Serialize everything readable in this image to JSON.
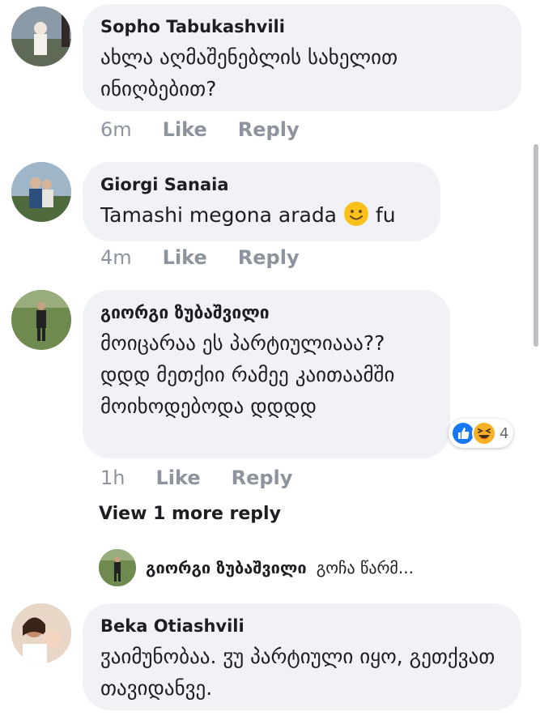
{
  "comments": [
    {
      "author": "Sopho Tabukashvili",
      "text": "ახლა აღმაშენებლის სახელით ინიღბებით?",
      "time": "6m",
      "like": "Like",
      "reply": "Reply"
    },
    {
      "author": "Giorgi Sanaia",
      "text_before_emoji": "Tamashi megona arada ",
      "emoji": "smiling-face",
      "text_after_emoji": " fu",
      "time": "4m",
      "like": "Like",
      "reply": "Reply"
    },
    {
      "author": "გიორგი ზუბაშვილი",
      "text": "მოიცარაა ეს პარტიულიააა?? დდდ მეთქიი რამეე კაითაამში მოიხოდებოდა დდდდ",
      "time": "1h",
      "like": "Like",
      "reply": "Reply",
      "reactions": {
        "icons": [
          "like-reaction-icon",
          "haha-reaction-icon"
        ],
        "count": "4"
      }
    },
    {
      "author": "Beka Otiashvili",
      "text": "ჳაიმუნობაა. ჳუ პარტიული იყო, გეთქვათ თავიდანვე.",
      "time": "",
      "like": "",
      "reply": ""
    }
  ],
  "view_more": "View 1 more reply",
  "reply_preview": {
    "author": "გიორგი ზუბაშვილი",
    "text": "გოჩა წარმ..."
  },
  "colors": {
    "bubble": "#f0f2f5",
    "meta": "#8d949e",
    "like_blue": "#1877f2",
    "haha_yellow": "#f7b125"
  }
}
